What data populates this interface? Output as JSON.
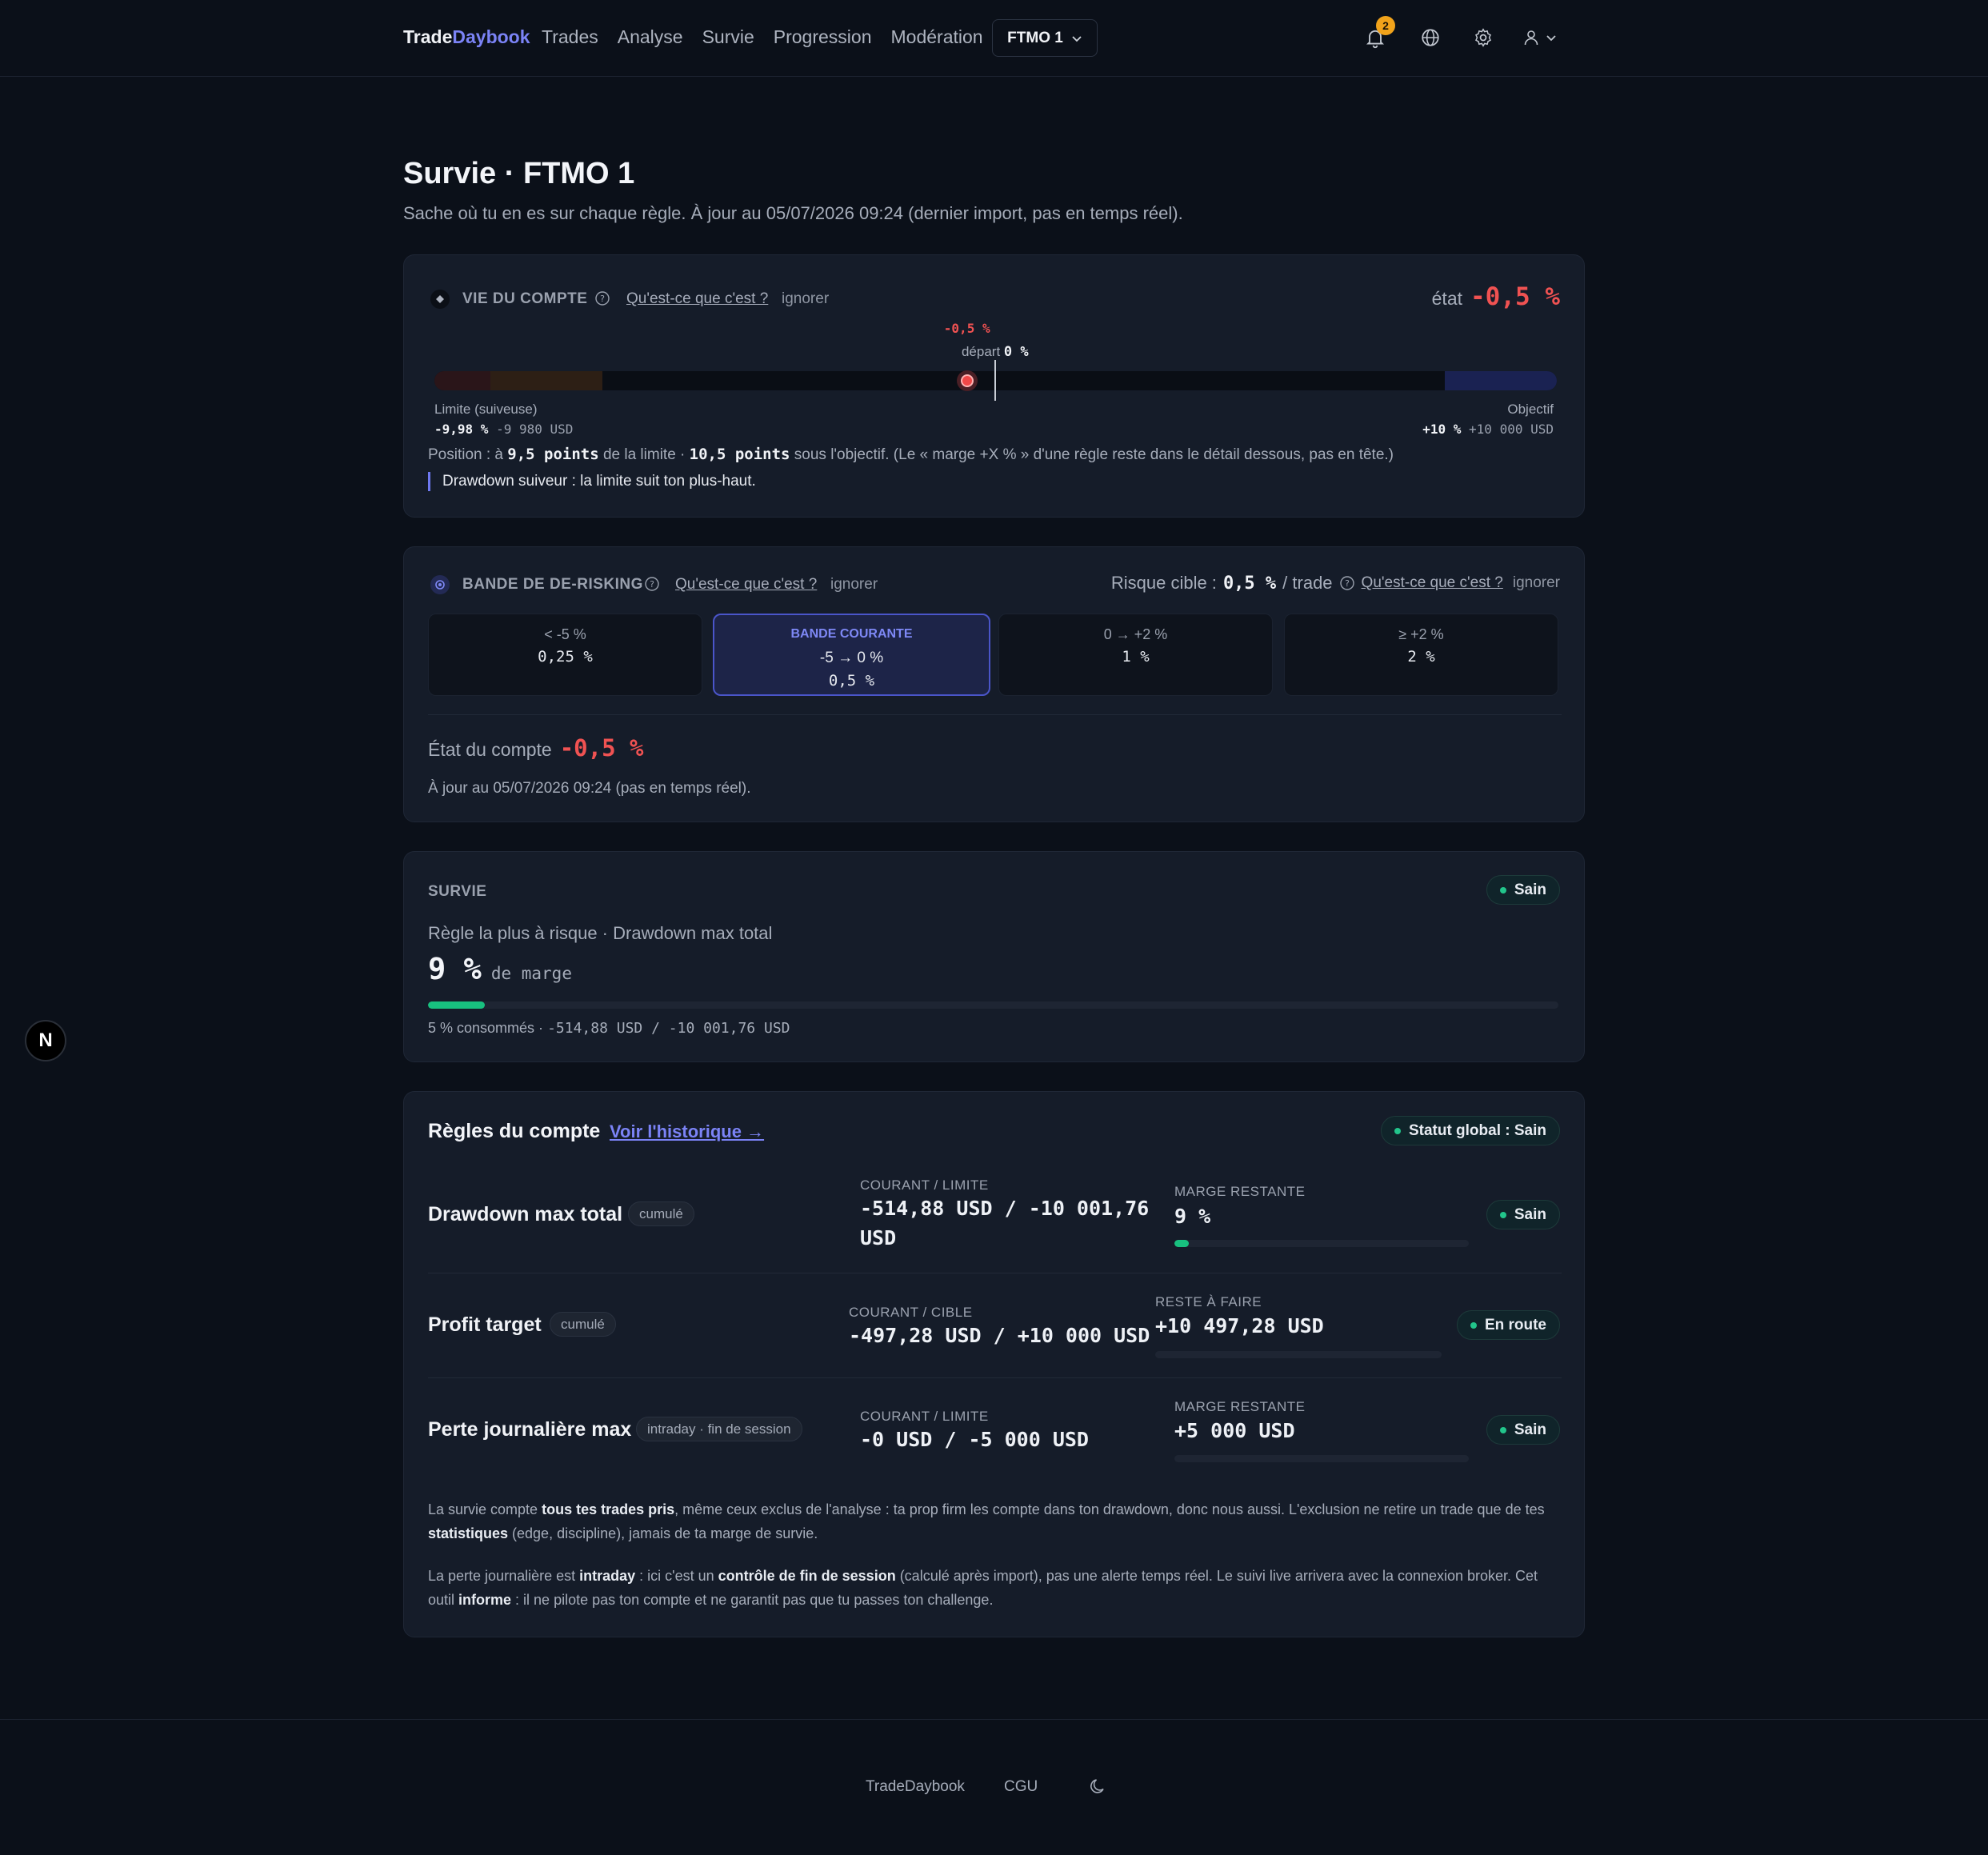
{
  "nav": {
    "brand_a": "Trade",
    "brand_b": "Daybook",
    "links": [
      "Trades",
      "Analyse",
      "Survie",
      "Progression",
      "Modération"
    ],
    "account_select": "FTMO 1",
    "notification_count": "2",
    "icons": [
      "bell-icon",
      "globe-icon",
      "gear-icon",
      "user-icon",
      "chevron-down-icon"
    ]
  },
  "header": {
    "title": "Survie · FTMO 1",
    "subtitle": "Sache où tu en es sur chaque règle. À jour au 05/07/2026 09:24 (dernier import, pas en temps réel)."
  },
  "life": {
    "label": "VIE DU COMPTE",
    "help_link": "Qu'est-ce que c'est ?",
    "ignore": "ignorer",
    "state_label": "état",
    "state_value": "-0,5 %",
    "marker_value": "-0,5 %",
    "start_label": "départ",
    "start_value": "0 %",
    "limit_label": "Limite (suiveuse)",
    "limit_pct": "-9,98 %",
    "limit_usd": "-9 980 USD",
    "target_label": "Objectif",
    "target_pct": "+10 %",
    "target_usd": "+10 000 USD",
    "position_prefix": "Position : à ",
    "position_points_limit": "9,5 points",
    "position_mid": " de la limite · ",
    "position_points_target": "10,5 points",
    "position_suffix": " sous l'objectif. (Le « marge +X % » d'une règle reste dans le détail dessous, pas en tête.)",
    "note": "Drawdown suiveur : la limite suit ton plus-haut.",
    "scale_min": -9.98,
    "scale_max": 10,
    "current": -0.5,
    "start": 0
  },
  "derisk": {
    "label": "BANDE DE DE-RISKING",
    "help_link": "Qu'est-ce que c'est ?",
    "ignore": "ignorer",
    "risk_label": "Risque cible :",
    "risk_value": "0,5 %",
    "risk_suffix": "/ trade",
    "help_link_2": "Qu'est-ce que c'est ?",
    "ignore_2": "ignorer",
    "bands": [
      {
        "range": "< -5 %",
        "value": "0,25 %"
      },
      {
        "current_label": "BANDE COURANTE",
        "range": "-5 → 0 %",
        "value": "0,5 %"
      },
      {
        "range": "0 → +2 %",
        "value": "1 %"
      },
      {
        "range": "≥ +2 %",
        "value": "2 %"
      }
    ],
    "state_label": "État du compte",
    "state_value": "-0,5 %",
    "updated": "À jour au 05/07/2026 09:24 (pas en temps réel)."
  },
  "survival": {
    "label": "SURVIE",
    "status": "Sain",
    "riskiest": "Règle la plus à risque · Drawdown max total",
    "margin_value": "9 %",
    "margin_suffix": "de marge",
    "consumed_fraction": 0.05,
    "consumed_text": "5 % consommés ·",
    "consumed_values": "-514,88 USD / -10 001,76 USD"
  },
  "rules": {
    "title": "Règles du compte",
    "history_link": "Voir l'historique →",
    "global_status": "Statut global : Sain",
    "items": [
      {
        "name": "Drawdown max total",
        "tag": "cumulé",
        "col_label": "COURANT / LIMITE",
        "col_value_1": "-514,88 USD / -10 001,76",
        "col_value_2": "USD",
        "right_label": "MARGE RESTANTE",
        "right_value": "9 %",
        "progress": 0.05,
        "status": "Sain"
      },
      {
        "name": "Profit target",
        "tag": "cumulé",
        "col_label": "COURANT / CIBLE",
        "col_value_1": "-497,28 USD / +10 000 USD",
        "right_label": "RESTE À FAIRE",
        "right_value": "+10 497,28 USD",
        "progress": 0,
        "status": "En route"
      },
      {
        "name": "Perte journalière max",
        "tag": "intraday · fin de session",
        "col_label": "COURANT / LIMITE",
        "col_value_1": "-0 USD / -5 000 USD",
        "right_label": "MARGE RESTANTE",
        "right_value": "+5 000 USD",
        "progress": 0,
        "status": "Sain"
      }
    ],
    "note1": {
      "a": "La survie compte ",
      "b": "tous tes trades pris",
      "c": ", même ceux exclus de l'analyse : ta prop firm les compte dans ton drawdown, donc nous aussi. L'exclusion ne retire un trade que de tes ",
      "d": "statistiques",
      "e": " (edge, discipline), jamais de ta marge de survie."
    },
    "note2": {
      "a": "La perte journalière est ",
      "b": "intraday",
      "c": " : ici c'est un ",
      "d": "contrôle de fin de session",
      "e": " (calculé après import), pas une alerte temps réel. Le suivi live arrivera avec la connexion broker. Cet outil ",
      "f": "informe",
      "g": " : il ne pilote pas ton compte et ne garantit pas que tu passes ton challenge."
    }
  },
  "footer": {
    "brand": "TradeDaybook",
    "cgu": "CGU",
    "fab_letter": "N"
  },
  "colors": {
    "accent": "#7b83f6",
    "negative": "#f05252",
    "healthy": "#22c58b",
    "background": "#0b1019"
  }
}
